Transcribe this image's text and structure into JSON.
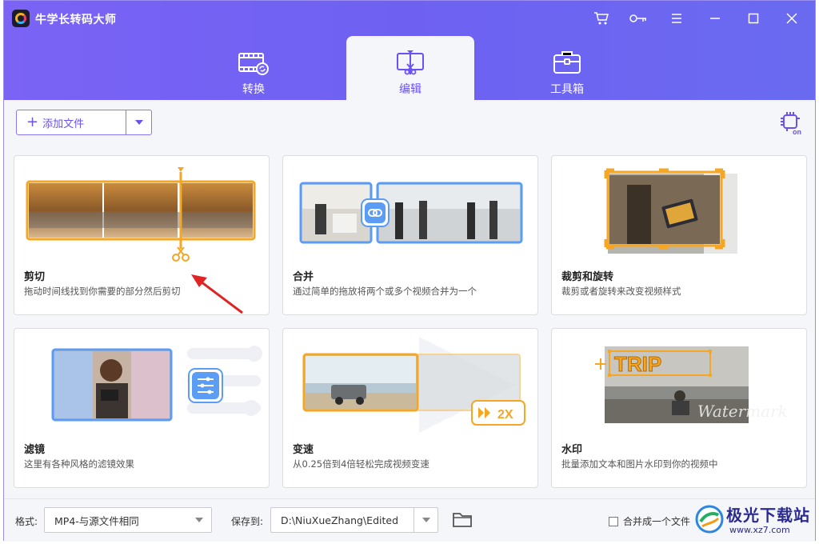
{
  "app": {
    "title": "牛学长转码大师"
  },
  "window_controls": [
    "cart-icon",
    "key-icon",
    "menu-icon",
    "minimize-icon",
    "maximize-icon",
    "close-icon"
  ],
  "tabs": [
    {
      "label": "转换",
      "icon": "convert-icon",
      "active": false
    },
    {
      "label": "编辑",
      "icon": "edit-icon",
      "active": true
    },
    {
      "label": "工具箱",
      "icon": "toolbox-icon",
      "active": false
    }
  ],
  "toolbar": {
    "add_file_label": "添加文件"
  },
  "cards": [
    {
      "title": "剪切",
      "desc": "拖动时间线找到你需要的部分然后剪切"
    },
    {
      "title": "合并",
      "desc": "通过简单的拖放将两个或多个视频合并为一个"
    },
    {
      "title": "裁剪和旋转",
      "desc": "裁剪或者旋转来改变视频样式"
    },
    {
      "title": "滤镜",
      "desc": "这里有各种风格的滤镜效果"
    },
    {
      "title": "变速",
      "desc": "从0.25倍到4倍轻松完成视频变速",
      "badge": "2X"
    },
    {
      "title": "水印",
      "desc": "批量添加文本和图片水印到你的视频中",
      "sample_text": "TRIP",
      "sample_script": "Watermark"
    }
  ],
  "footer": {
    "format_label": "格式:",
    "format_value": "MP4-与源文件相同",
    "save_label": "保存到:",
    "save_value": "D:\\NiuXueZhang\\Edited",
    "merge_label": "合并成一个文件"
  },
  "site_watermark": {
    "text": "极光下载站",
    "url": "www.xz7.com"
  },
  "colors": {
    "accent": "#6a52f2",
    "header": "#7463f4",
    "orange": "#f5a623",
    "blue": "#5b9cf5"
  }
}
